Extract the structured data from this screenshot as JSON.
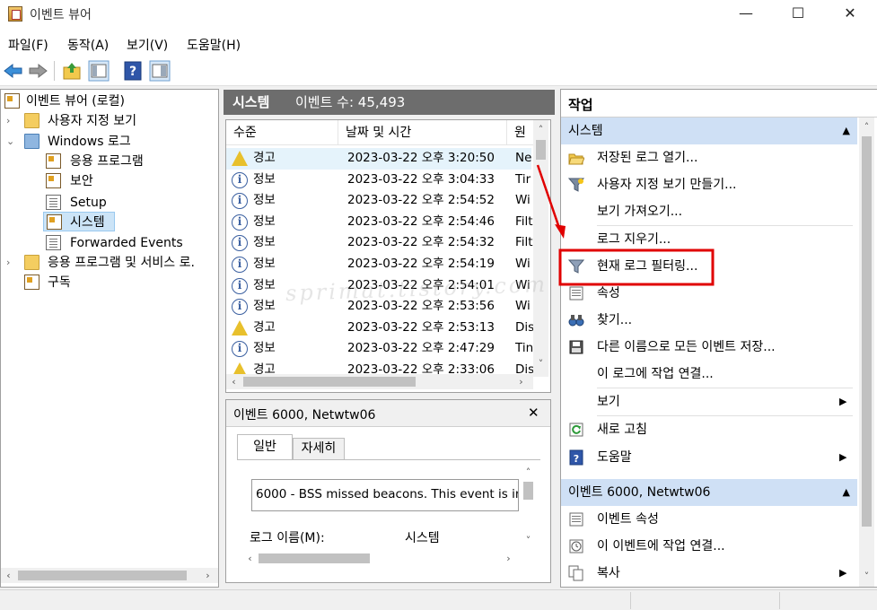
{
  "window": {
    "title": "이벤트 뷰어",
    "minimize_glyph": "—",
    "maximize_glyph": "☐",
    "close_glyph": "✕"
  },
  "menu": [
    "파일(F)",
    "동작(A)",
    "보기(V)",
    "도움말(H)"
  ],
  "toolbar": {
    "icons": [
      "back-arrow-icon",
      "forward-arrow-icon",
      "up-folder-icon",
      "show-hide-tree-icon",
      "help-icon",
      "show-hide-action-pane-icon"
    ]
  },
  "tree": {
    "root": "이벤트 뷰어 (로컬)",
    "custom_views": "사용자 지정 보기",
    "windows_logs": "Windows 로그",
    "application": "응용 프로그램",
    "security": "보안",
    "setup": "Setup",
    "system": "시스템",
    "forwarded": "Forwarded Events",
    "apps_services": "응용 프로그램 및 서비스 로.",
    "subscriptions": "구독"
  },
  "event_list": {
    "header_name": "시스템",
    "header_count": "이벤트 수: 45,493",
    "columns": [
      "수준",
      "날짜 및 시간",
      "원"
    ],
    "rows": [
      {
        "level": "경고",
        "type": "warning",
        "datetime": "2023-03-22 오후 3:20:50",
        "source": "Ne"
      },
      {
        "level": "정보",
        "type": "info",
        "datetime": "2023-03-22 오후 3:04:33",
        "source": "Tir"
      },
      {
        "level": "정보",
        "type": "info",
        "datetime": "2023-03-22 오후 2:54:52",
        "source": "Wi"
      },
      {
        "level": "정보",
        "type": "info",
        "datetime": "2023-03-22 오후 2:54:46",
        "source": "Filt"
      },
      {
        "level": "정보",
        "type": "info",
        "datetime": "2023-03-22 오후 2:54:32",
        "source": "Filt"
      },
      {
        "level": "정보",
        "type": "info",
        "datetime": "2023-03-22 오후 2:54:19",
        "source": "Wi"
      },
      {
        "level": "정보",
        "type": "info",
        "datetime": "2023-03-22 오후 2:54:01",
        "source": "Wi"
      },
      {
        "level": "정보",
        "type": "info",
        "datetime": "2023-03-22 오후 2:53:56",
        "source": "Wi"
      },
      {
        "level": "경고",
        "type": "warning",
        "datetime": "2023-03-22 오후 2:53:13",
        "source": "Dis"
      },
      {
        "level": "정보",
        "type": "info",
        "datetime": "2023-03-22 오후 2:47:29",
        "source": "Tin"
      },
      {
        "level": "경고",
        "type": "warning",
        "datetime": "2023-03-22 오후 2:33:06",
        "source": "Dis"
      }
    ]
  },
  "detail": {
    "title": "이벤트 6000, Netwtw06",
    "close_glyph": "✕",
    "tab_general": "일반",
    "tab_details": "자세히",
    "description": "6000 - BSS missed beacons. This event is ir",
    "log_name_label": "로그 이름(M):",
    "log_name_value": "시스템"
  },
  "actions": {
    "header": "작업",
    "section1": "시스템",
    "open_saved": "저장된 로그 열기...",
    "create_custom": "사용자 지정 보기 만들기...",
    "import_custom": "보기 가져오기...",
    "clear_log": "로그 지우기...",
    "filter_log": "현재 로그 필터링...",
    "properties": "속성",
    "find": "찾기...",
    "save_all": "다른 이름으로 모든 이벤트 저장...",
    "attach_task": "이 로그에 작업 연결...",
    "view": "보기",
    "refresh": "새로 고침",
    "help": "도움말",
    "section2": "이벤트 6000, Netwtw06",
    "event_props": "이벤트 속성",
    "attach_event_task": "이 이벤트에 작업 연결...",
    "copy": "복사"
  },
  "annotation": {
    "highlight_color": "#e00000"
  },
  "watermark": "sprimat.tistory.com"
}
